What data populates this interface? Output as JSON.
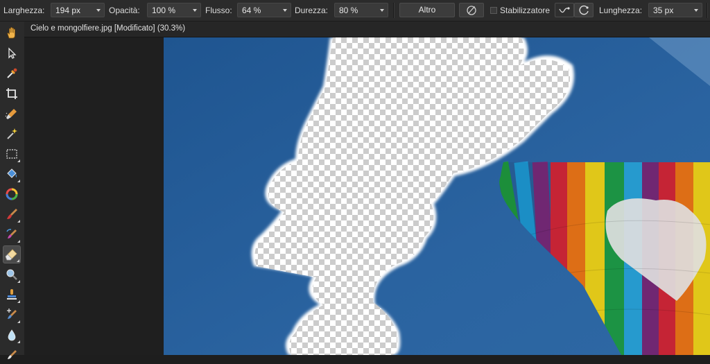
{
  "toolbar": {
    "width_label": "Larghezza:",
    "width_value": "194 px",
    "opacity_label": "Opacità:",
    "opacity_value": "100 %",
    "flow_label": "Flusso:",
    "flow_value": "64 %",
    "hardness_label": "Durezza:",
    "hardness_value": "80 %",
    "more_button": "Altro",
    "stabilizer_label": "Stabilizzatore",
    "length_label": "Lunghezza:",
    "length_value": "35 px"
  },
  "document": {
    "tab_title": "Cielo e mongolfiere.jpg [Modificato] (30.3%)"
  },
  "tools": [
    {
      "name": "hand-tool-icon"
    },
    {
      "name": "move-tool-icon"
    },
    {
      "name": "color-picker-tool-icon"
    },
    {
      "name": "crop-tool-icon"
    },
    {
      "name": "selection-brush-tool-icon"
    },
    {
      "name": "magic-wand-tool-icon"
    },
    {
      "name": "rectangle-marquee-tool-icon"
    },
    {
      "name": "flood-fill-tool-icon"
    },
    {
      "name": "gradient-tool-icon"
    },
    {
      "name": "paint-brush-tool-icon"
    },
    {
      "name": "color-replacement-tool-icon"
    },
    {
      "name": "eraser-brush-tool-icon",
      "active": true
    },
    {
      "name": "dodge-tool-icon"
    },
    {
      "name": "clone-stamp-tool-icon"
    },
    {
      "name": "healing-brush-tool-icon"
    },
    {
      "name": "blur-tool-icon"
    },
    {
      "name": "smudge-tool-icon"
    }
  ],
  "colors": {
    "sky": "#2a5e9a",
    "toolbar_bg": "#2b2b2b"
  }
}
